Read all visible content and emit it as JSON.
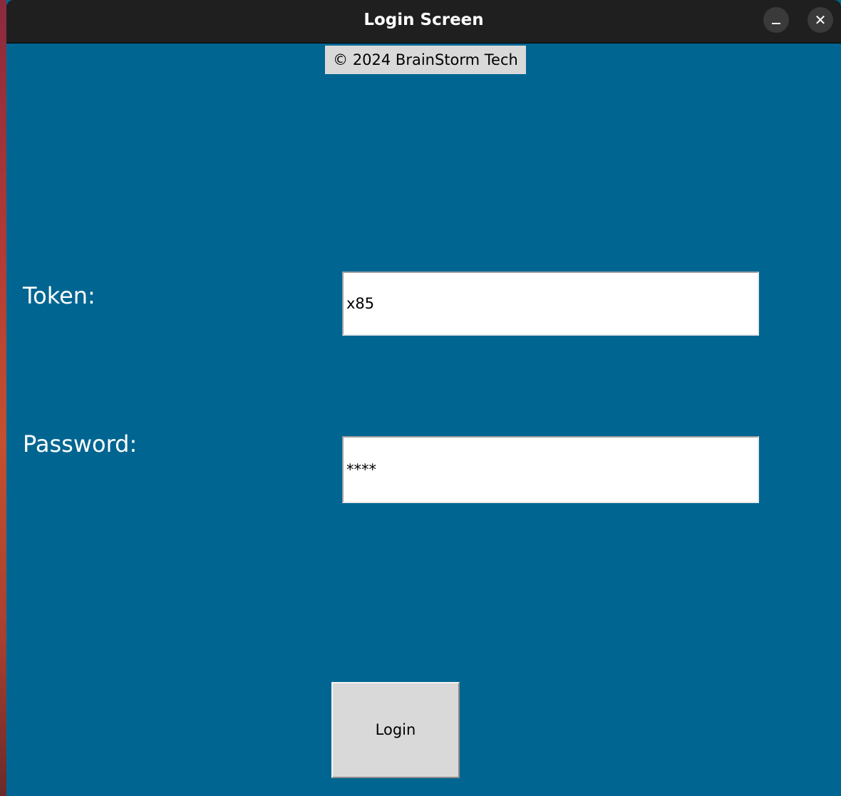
{
  "window": {
    "title": "Login Screen",
    "minimize_glyph": "–",
    "close_glyph": "✕"
  },
  "footer": {
    "copyright": "© 2024 BrainStorm Tech"
  },
  "form": {
    "token_label": "Token:",
    "token_value": "x85",
    "password_label": "Password:",
    "password_value": "****",
    "login_label": "Login"
  },
  "colors": {
    "window_background": "#006591",
    "titlebar_background": "#1f1f1f",
    "button_background": "#d9d9d9"
  },
  "icons": {
    "minimize": "minimize-icon",
    "close": "close-icon"
  }
}
